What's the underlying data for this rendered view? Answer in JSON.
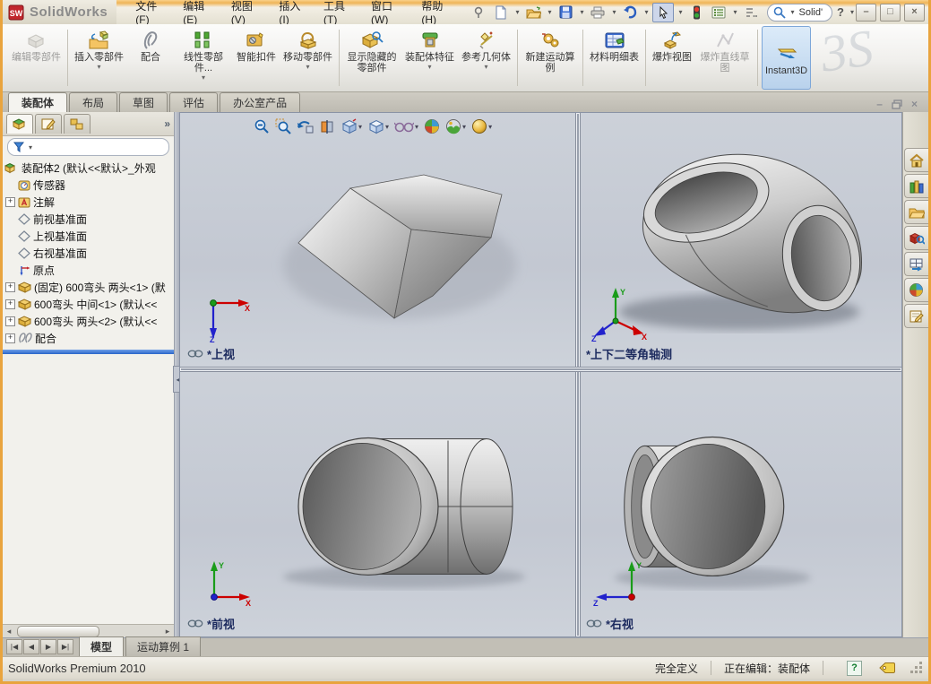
{
  "window": {
    "logo": "SolidWorks",
    "logo_badge": "SW",
    "menus": [
      "文件(F)",
      "编辑(E)",
      "视图(V)",
      "插入(I)",
      "工具(T)",
      "窗口(W)",
      "帮助(H)"
    ],
    "search_value": "Solid'",
    "help": "?"
  },
  "ribbon": {
    "buttons": [
      {
        "label": "编辑零部件",
        "disabled": true
      },
      {
        "label": "插入零部件",
        "dropdown": true
      },
      {
        "label": "配合"
      },
      {
        "label": "线性零部件...",
        "dropdown": true
      },
      {
        "label": "智能扣件"
      },
      {
        "label": "移动零部件",
        "dropdown": true
      },
      {
        "label": "显示隐藏的零部件"
      },
      {
        "label": "装配体特征",
        "dropdown": true
      },
      {
        "label": "参考几何体",
        "dropdown": true
      },
      {
        "label": "新建运动算例"
      },
      {
        "label": "材料明细表"
      },
      {
        "label": "爆炸视图"
      },
      {
        "label": "爆炸直线草图",
        "disabled": true
      },
      {
        "label": "Instant3D",
        "active": true
      }
    ]
  },
  "command_tabs": [
    {
      "label": "装配体",
      "active": true
    },
    {
      "label": "布局"
    },
    {
      "label": "草图"
    },
    {
      "label": "评估"
    },
    {
      "label": "办公室产品"
    }
  ],
  "feature_tree": {
    "root": "装配体2 (默认<<默认>_外观",
    "items": [
      {
        "label": "传感器"
      },
      {
        "label": "注解",
        "expandable": true
      },
      {
        "label": "前视基准面"
      },
      {
        "label": "上视基准面"
      },
      {
        "label": "右视基准面"
      },
      {
        "label": "原点"
      },
      {
        "label": "(固定) 600弯头 两头<1> (默",
        "expandable": true
      },
      {
        "label": "600弯头 中间<1> (默认<<",
        "expandable": true
      },
      {
        "label": "600弯头 两头<2> (默认<<",
        "expandable": true
      },
      {
        "label": "配合",
        "expandable": true
      }
    ]
  },
  "viewports": [
    {
      "label": "*上视",
      "linked": true
    },
    {
      "label": "*上下二等角轴测",
      "linked": false
    },
    {
      "label": "*前视",
      "linked": true
    },
    {
      "label": "*右视",
      "linked": true
    }
  ],
  "triad": {
    "x": "X",
    "y": "Y",
    "z": "Z"
  },
  "doc_tabs": [
    {
      "label": "模型",
      "active": true
    },
    {
      "label": "运动算例 1"
    }
  ],
  "status_bar": {
    "product": "SolidWorks Premium 2010",
    "define_state": "完全定义",
    "editing": "正在编辑：装配体"
  },
  "colors": {
    "frame_orange": "#e9a43e",
    "viewport_bg": "#c6cbd4",
    "selection_blue": "#2a66c9",
    "instant3d_bg": "#cfe0f2",
    "label_navy": "#1c2a5e"
  }
}
